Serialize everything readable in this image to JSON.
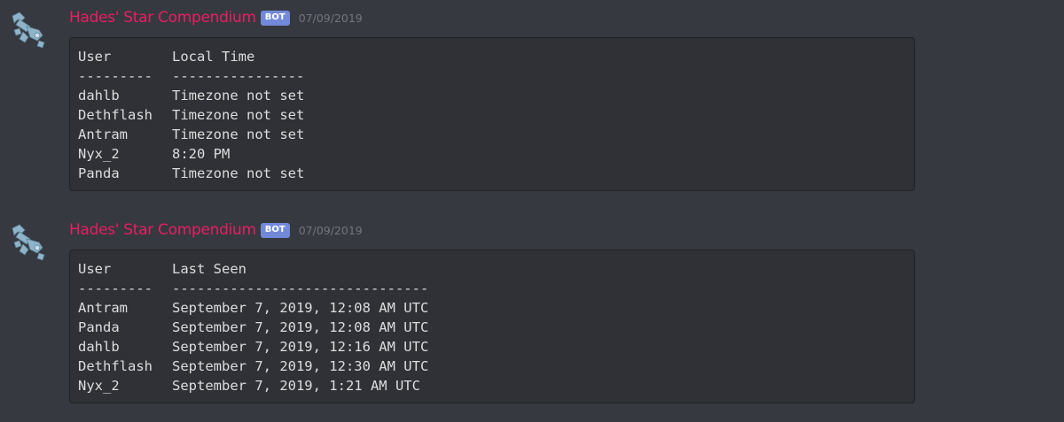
{
  "messages": [
    {
      "author": "Hades' Star Compendium",
      "bot_tag": "BOT",
      "timestamp": "07/09/2019",
      "avatar_icon": "spaceship-icon",
      "table": {
        "headers": [
          "User",
          "Local Time"
        ],
        "separators": [
          "---------",
          "----------------"
        ],
        "rows": [
          [
            "dahlb",
            "Timezone not set"
          ],
          [
            "Dethflash",
            "Timezone not set"
          ],
          [
            "Antram",
            "Timezone not set"
          ],
          [
            "Nyx_2",
            "8:20 PM"
          ],
          [
            "Panda",
            "Timezone not set"
          ]
        ]
      }
    },
    {
      "author": "Hades' Star Compendium",
      "bot_tag": "BOT",
      "timestamp": "07/09/2019",
      "avatar_icon": "spaceship-icon",
      "table": {
        "headers": [
          "User",
          "Last Seen"
        ],
        "separators": [
          "---------",
          "-------------------------------"
        ],
        "rows": [
          [
            "Antram",
            "September 7, 2019, 12:08 AM UTC"
          ],
          [
            "Panda",
            "September 7, 2019, 12:08 AM UTC"
          ],
          [
            "dahlb",
            "September 7, 2019, 12:16 AM UTC"
          ],
          [
            "Dethflash",
            "September 7, 2019, 12:30 AM UTC"
          ],
          [
            "Nyx_2",
            "September 7, 2019, 1:21 AM UTC"
          ]
        ]
      }
    }
  ],
  "colors": {
    "background": "#36393f",
    "codeblock": "#2f3136",
    "username": "#e91e63",
    "bot_tag": "#7289da",
    "timestamp": "#72767d",
    "text": "#dcddde",
    "avatar": "#8fb4c9"
  }
}
